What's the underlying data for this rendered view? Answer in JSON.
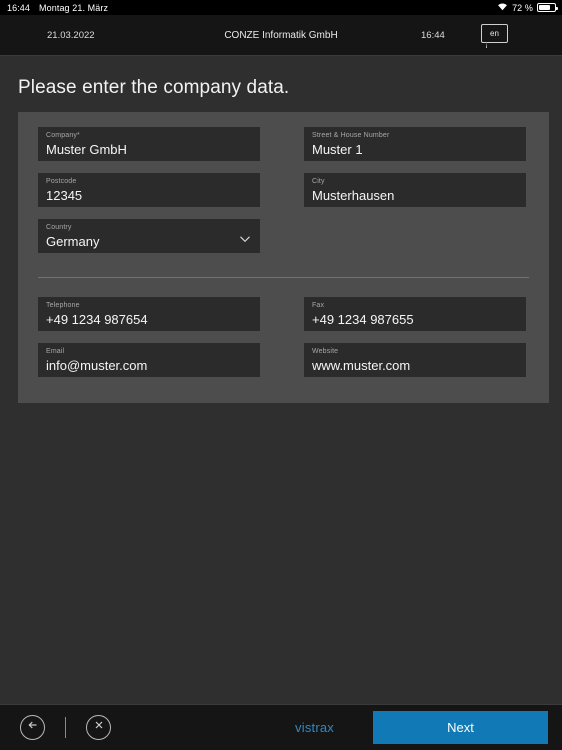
{
  "statusbar": {
    "time": "16:44",
    "date": "Montag 21. März",
    "battery_percent": "72 %",
    "battery_level": 72,
    "wifi_icon": "wifi-icon",
    "battery_icon": "battery-icon"
  },
  "header": {
    "date": "21.03.2022",
    "title": "CONZE Informatik GmbH",
    "time": "16:44",
    "language": "en"
  },
  "page": {
    "title": "Please enter the company data."
  },
  "form": {
    "fields": [
      {
        "label": "Company*",
        "value": "Muster GmbH",
        "name": "company"
      },
      {
        "label": "Street & House Number",
        "value": "Muster 1",
        "name": "street"
      },
      {
        "label": "Postcode",
        "value": "12345",
        "name": "postcode"
      },
      {
        "label": "City",
        "value": "Musterhausen",
        "name": "city"
      },
      {
        "label": "Country",
        "value": "Germany",
        "name": "country"
      },
      {
        "label": "Telephone",
        "value": "+49 1234 987654",
        "name": "telephone"
      },
      {
        "label": "Fax",
        "value": "+49 1234 987655",
        "name": "fax"
      },
      {
        "label": "Email",
        "value": "info@muster.com",
        "name": "email"
      },
      {
        "label": "Website",
        "value": "www.muster.com",
        "name": "website"
      }
    ]
  },
  "bottombar": {
    "back_icon": "arrow-left-circle-icon",
    "close_icon": "close-circle-icon",
    "brand": "vistrax",
    "next_label": "Next"
  },
  "colors": {
    "accent": "#1179b5",
    "brand": "#2f89c4",
    "card_bg": "#4d4d4d",
    "field_bg": "#2b2b2b",
    "page_bg": "#2f2f2f"
  }
}
